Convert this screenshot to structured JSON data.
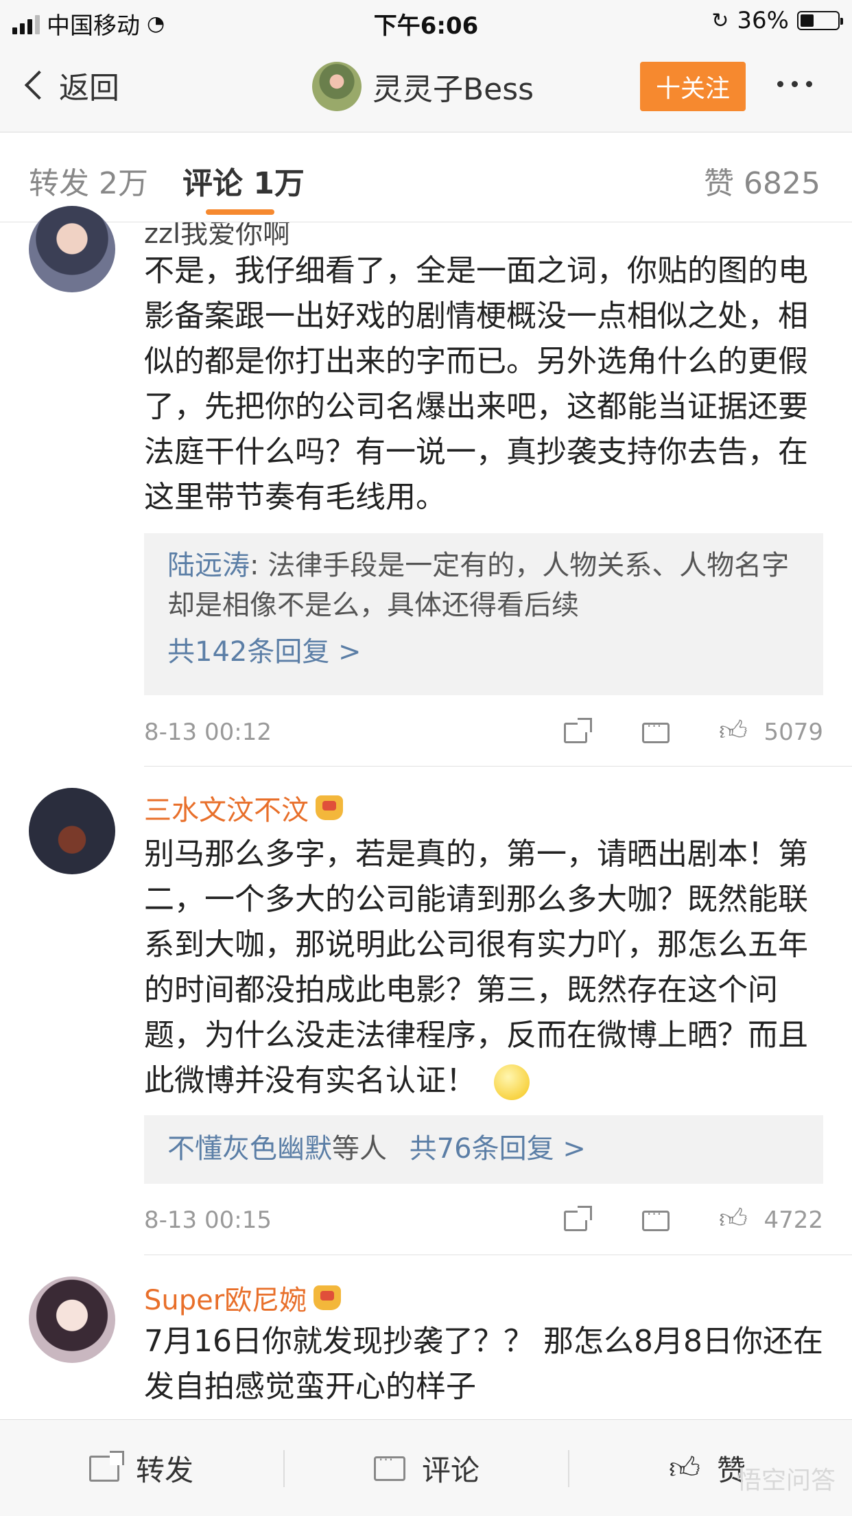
{
  "status": {
    "carrier": "中国移动",
    "time": "下午6:06",
    "battery": "36%",
    "battery_level": 0.36
  },
  "nav": {
    "back": "返回",
    "user": "灵灵子Bess",
    "follow": "十关注"
  },
  "tabs": {
    "repost": "转发 2万",
    "comments": "评论 1万",
    "likes": "赞 6825"
  },
  "comments": [
    {
      "name": "zzl我爱你啊",
      "text": "不是，我仔细看了，全是一面之词，你贴的图的电影备案跟一出好戏的剧情梗概没一点相似之处，相似的都是你打出来的字而已。另外选角什么的更假了，先把你的公司名爆出来吧，这都能当证据还要法庭干什么吗？有一说一，真抄袭支持你去告，在这里带节奏有毛线用。",
      "reply_user": "陆远涛",
      "reply_text": ": 法律手段是一定有的，人物关系、人物名字却是相像不是么，具体还得看后续",
      "reply_more": "共142条回复 >",
      "date": "8-13 00:12",
      "likes": "5079"
    },
    {
      "name": "三水文汶不汶",
      "text": "别马那么多字，若是真的，第一，请晒出剧本！第二，一个多大的公司能请到那么多大咖？既然能联系到大咖，那说明此公司很有实力吖，那怎么五年的时间都没拍成此电影？第三，既然存在这个问题，为什么没走法律程序，反而在微博上晒？而且此微博并没有实名认证！",
      "reply_user": "不懂灰色幽默",
      "reply_suffix": "等人",
      "reply_more": "共76条回复 >",
      "date": "8-13 00:15",
      "likes": "4722"
    },
    {
      "name": "Super欧尼婉",
      "text": "7月16日你就发现抄袭了？？ 那怎么8月8日你还在发自拍感觉蛮开心的样子"
    }
  ],
  "bottom": {
    "repost": "转发",
    "comment": "评论",
    "like": "赞"
  },
  "watermark": "悟空问答",
  "colors": {
    "accent": "#f6892f",
    "username": "#e86f2a",
    "link": "#5b7ea6"
  }
}
